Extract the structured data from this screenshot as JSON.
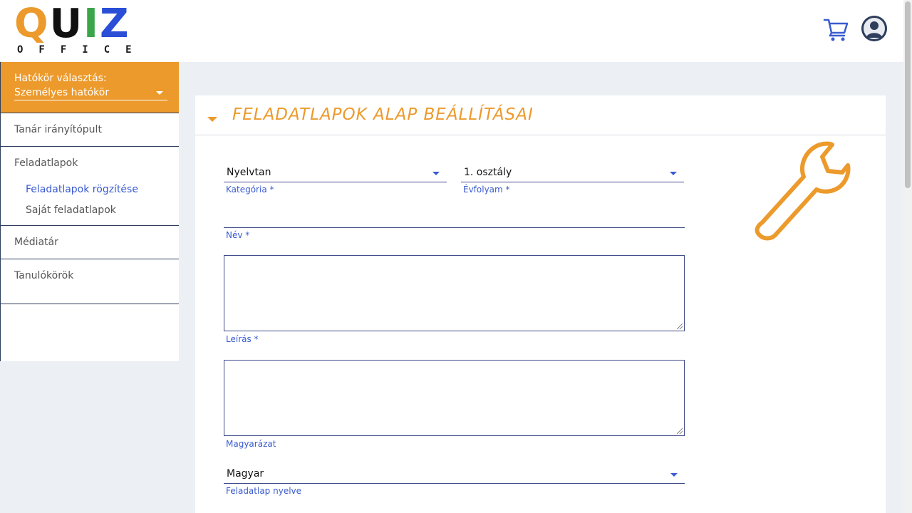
{
  "header": {
    "logo_letters": [
      "Q",
      "U",
      "I",
      "Z"
    ],
    "logo_subtitle": "OFFICE"
  },
  "colors": {
    "accent": "#ec9a2c",
    "link": "#3a5bd0",
    "navy": "#2e3e5c",
    "logo_q": "#ec9a2c",
    "logo_u": "#111111",
    "logo_i": "#3aa64a",
    "logo_z": "#2a4fd6"
  },
  "sidebar": {
    "scope_label": "Hatókör választás:",
    "scope_value": "Személyes hatókör",
    "items": [
      {
        "label": "Tanár irányítópult"
      },
      {
        "label": "Feladatlapok"
      },
      {
        "label": "Médiatár"
      },
      {
        "label": "Tanulókörök"
      }
    ],
    "subitems": [
      {
        "label": "Feladatlapok rögzítése",
        "active": true
      },
      {
        "label": "Saját feladatlapok",
        "active": false
      }
    ]
  },
  "card": {
    "title": "FELADATLAPOK ALAP BEÁLLÍTÁSAI",
    "fields": {
      "category": {
        "value": "Nyelvtan",
        "label": "Kategória *"
      },
      "grade": {
        "value": "1. osztály",
        "label": "Évfolyam *"
      },
      "name": {
        "value": "",
        "label": "Név *"
      },
      "description": {
        "label": "Leírás *"
      },
      "explanation": {
        "label": "Magyarázat"
      },
      "language": {
        "value": "Magyar",
        "label": "Feladatlap nyelve"
      }
    }
  },
  "icons": [
    "cart-icon",
    "avatar-icon",
    "wrench-icon",
    "chevron-down-icon"
  ]
}
